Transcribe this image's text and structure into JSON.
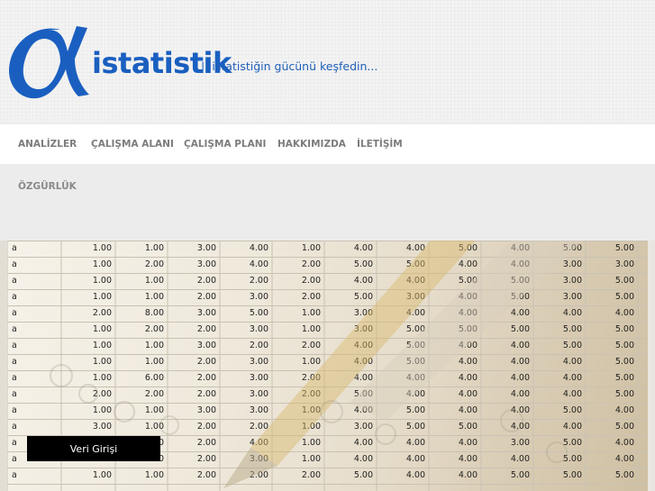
{
  "logo": {
    "mark": "α",
    "word": "istatistik",
    "tagline": "|| istatistiğin gücünü keşfedin..."
  },
  "nav": {
    "items": [
      "ANALİZLER",
      "ÇALIŞMA ALANI",
      "ÇALIŞMA PLANI",
      "HAKKIMIZDA",
      "İLETİŞİM"
    ],
    "second_row": [
      "ÖZGÜRLÜK"
    ]
  },
  "slider": {
    "row_label": "a",
    "rows": [
      [
        "1.00",
        "1.00",
        "3.00",
        "4.00",
        "1.00",
        "4.00",
        "4.00",
        "5.00",
        "4.00",
        "5.00",
        "5.00"
      ],
      [
        "1.00",
        "2.00",
        "3.00",
        "4.00",
        "2.00",
        "5.00",
        "5.00",
        "4.00",
        "4.00",
        "3.00",
        "3.00"
      ],
      [
        "1.00",
        "1.00",
        "2.00",
        "2.00",
        "2.00",
        "4.00",
        "4.00",
        "5.00",
        "5.00",
        "3.00",
        "5.00"
      ],
      [
        "1.00",
        "1.00",
        "2.00",
        "3.00",
        "2.00",
        "5.00",
        "3.00",
        "4.00",
        "5.00",
        "3.00",
        "5.00"
      ],
      [
        "2.00",
        "8.00",
        "3.00",
        "5.00",
        "1.00",
        "3.00",
        "4.00",
        "4.00",
        "4.00",
        "4.00",
        "4.00"
      ],
      [
        "1.00",
        "2.00",
        "2.00",
        "3.00",
        "1.00",
        "3.00",
        "5.00",
        "5.00",
        "5.00",
        "5.00",
        "5.00"
      ],
      [
        "1.00",
        "1.00",
        "3.00",
        "2.00",
        "2.00",
        "4.00",
        "5.00",
        "4.00",
        "4.00",
        "5.00",
        "5.00"
      ],
      [
        "1.00",
        "1.00",
        "2.00",
        "3.00",
        "1.00",
        "4.00",
        "5.00",
        "4.00",
        "4.00",
        "4.00",
        "5.00"
      ],
      [
        "1.00",
        "6.00",
        "2.00",
        "3.00",
        "2.00",
        "4.00",
        "4.00",
        "4.00",
        "4.00",
        "4.00",
        "5.00"
      ],
      [
        "2.00",
        "2.00",
        "2.00",
        "3.00",
        "2.00",
        "5.00",
        "4.00",
        "4.00",
        "4.00",
        "4.00",
        "5.00"
      ],
      [
        "1.00",
        "1.00",
        "3.00",
        "3.00",
        "1.00",
        "4.00",
        "5.00",
        "4.00",
        "4.00",
        "5.00",
        "4.00"
      ],
      [
        "3.00",
        "1.00",
        "2.00",
        "2.00",
        "1.00",
        "3.00",
        "5.00",
        "5.00",
        "4.00",
        "4.00",
        "5.00"
      ],
      [
        "1.00",
        "1.00",
        "2.00",
        "4.00",
        "1.00",
        "4.00",
        "4.00",
        "4.00",
        "3.00",
        "5.00",
        "4.00"
      ],
      [
        "1.00",
        "1.00",
        "2.00",
        "3.00",
        "1.00",
        "4.00",
        "4.00",
        "4.00",
        "4.00",
        "5.00",
        "4.00"
      ],
      [
        "1.00",
        "1.00",
        "2.00",
        "2.00",
        "2.00",
        "5.00",
        "4.00",
        "4.00",
        "5.00",
        "5.00",
        "5.00"
      ]
    ],
    "button_label": "Veri Girişi"
  },
  "colors": {
    "brand_blue": "#1a5fc0",
    "nav_text": "#7c7c7c",
    "button_bg": "#000000"
  }
}
